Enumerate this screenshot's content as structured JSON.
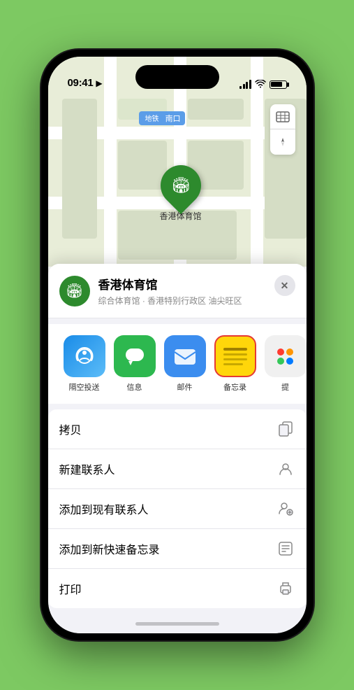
{
  "statusBar": {
    "time": "09:41",
    "locationIcon": "▶"
  },
  "mapControls": {
    "mapIcon": "🗺",
    "locationIcon": "⬆"
  },
  "mapLabel": {
    "text": "南口"
  },
  "locationPin": {
    "label": "香港体育馆",
    "emoji": "🏟"
  },
  "venueHeader": {
    "name": "香港体育馆",
    "subtitle": "综合体育馆 · 香港特别行政区 油尖旺区",
    "closeLabel": "✕"
  },
  "shareItems": [
    {
      "id": "airdrop",
      "label": "隔空投送",
      "icon": ""
    },
    {
      "id": "messages",
      "label": "信息",
      "icon": "💬"
    },
    {
      "id": "mail",
      "label": "邮件",
      "icon": "✉"
    },
    {
      "id": "notes",
      "label": "备忘录",
      "icon": ""
    },
    {
      "id": "more",
      "label": "提",
      "icon": ""
    }
  ],
  "actions": [
    {
      "id": "copy",
      "label": "拷贝",
      "icon": "copy"
    },
    {
      "id": "new-contact",
      "label": "新建联系人",
      "icon": "person"
    },
    {
      "id": "add-existing",
      "label": "添加到现有联系人",
      "icon": "person-add"
    },
    {
      "id": "quick-note",
      "label": "添加到新快速备忘录",
      "icon": "note"
    },
    {
      "id": "print",
      "label": "打印",
      "icon": "print"
    }
  ]
}
